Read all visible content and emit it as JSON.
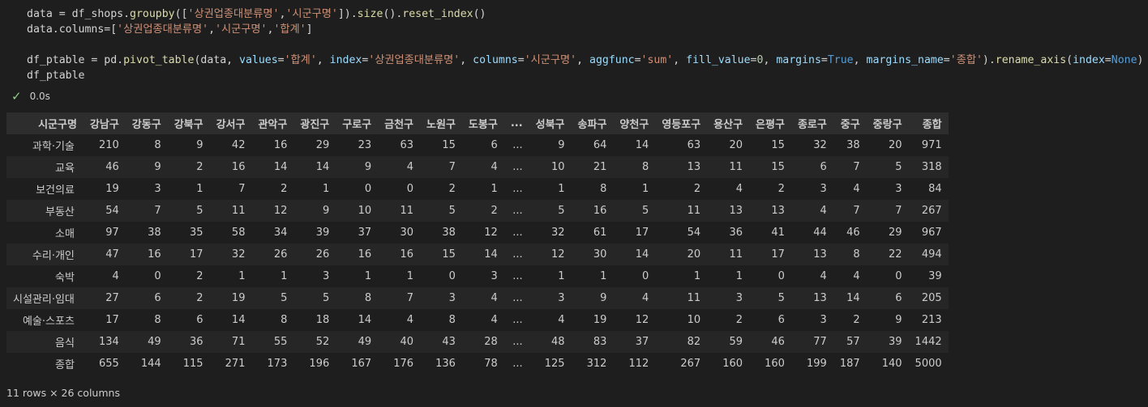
{
  "code_lines": [
    [
      {
        "t": "data = df_shops."
      },
      {
        "t": "groupby",
        "c": "fn"
      },
      {
        "t": "(["
      },
      {
        "t": "'상권업종대분류명'",
        "c": "str"
      },
      {
        "t": ","
      },
      {
        "t": "'시군구명'",
        "c": "str"
      },
      {
        "t": "])."
      },
      {
        "t": "size",
        "c": "fn"
      },
      {
        "t": "()."
      },
      {
        "t": "reset_index",
        "c": "fn"
      },
      {
        "t": "()"
      }
    ],
    [
      {
        "t": "data.columns=["
      },
      {
        "t": "'상권업종대분류명'",
        "c": "str"
      },
      {
        "t": ","
      },
      {
        "t": "'시군구명'",
        "c": "str"
      },
      {
        "t": ","
      },
      {
        "t": "'합계'",
        "c": "str"
      },
      {
        "t": "]"
      }
    ],
    [],
    [
      {
        "t": "df_ptable = pd."
      },
      {
        "t": "pivot_table",
        "c": "fn"
      },
      {
        "t": "(data, "
      },
      {
        "t": "values",
        "c": "var"
      },
      {
        "t": "="
      },
      {
        "t": "'합계'",
        "c": "str"
      },
      {
        "t": ", "
      },
      {
        "t": "index",
        "c": "var"
      },
      {
        "t": "="
      },
      {
        "t": "'상권업종대분류명'",
        "c": "str"
      },
      {
        "t": ", "
      },
      {
        "t": "columns",
        "c": "var"
      },
      {
        "t": "="
      },
      {
        "t": "'시군구명'",
        "c": "str"
      },
      {
        "t": ", "
      },
      {
        "t": "aggfunc",
        "c": "var"
      },
      {
        "t": "="
      },
      {
        "t": "'sum'",
        "c": "str"
      },
      {
        "t": ", "
      },
      {
        "t": "fill_value",
        "c": "var"
      },
      {
        "t": "="
      },
      {
        "t": "0",
        "c": "num"
      },
      {
        "t": ", "
      },
      {
        "t": "margins",
        "c": "var"
      },
      {
        "t": "="
      },
      {
        "t": "True",
        "c": "kw"
      },
      {
        "t": ", "
      },
      {
        "t": "margins_name",
        "c": "var"
      },
      {
        "t": "="
      },
      {
        "t": "'종합'",
        "c": "str"
      },
      {
        "t": ")."
      },
      {
        "t": "rename_axis",
        "c": "fn"
      },
      {
        "t": "("
      },
      {
        "t": "index",
        "c": "var"
      },
      {
        "t": "="
      },
      {
        "t": "None",
        "c": "kw"
      },
      {
        "t": ")"
      }
    ],
    [
      {
        "t": "df_ptable"
      }
    ]
  ],
  "status": {
    "check_icon": "check-icon",
    "time": "0.0s"
  },
  "table": {
    "headers": [
      "시군구명",
      "강남구",
      "강동구",
      "강북구",
      "강서구",
      "관악구",
      "광진구",
      "구로구",
      "금천구",
      "노원구",
      "도봉구",
      "...",
      "성북구",
      "송파구",
      "양천구",
      "영등포구",
      "용산구",
      "은평구",
      "종로구",
      "중구",
      "중랑구",
      "종합"
    ],
    "rows": [
      [
        "과학·기술",
        "210",
        "8",
        "9",
        "42",
        "16",
        "29",
        "23",
        "63",
        "15",
        "6",
        "...",
        "9",
        "64",
        "14",
        "63",
        "20",
        "15",
        "32",
        "38",
        "20",
        "971"
      ],
      [
        "교육",
        "46",
        "9",
        "2",
        "16",
        "14",
        "14",
        "9",
        "4",
        "7",
        "4",
        "...",
        "10",
        "21",
        "8",
        "13",
        "11",
        "15",
        "6",
        "7",
        "5",
        "318"
      ],
      [
        "보건의료",
        "19",
        "3",
        "1",
        "7",
        "2",
        "1",
        "0",
        "0",
        "2",
        "1",
        "...",
        "1",
        "8",
        "1",
        "2",
        "4",
        "2",
        "3",
        "4",
        "3",
        "84"
      ],
      [
        "부동산",
        "54",
        "7",
        "5",
        "11",
        "12",
        "9",
        "10",
        "11",
        "5",
        "2",
        "...",
        "5",
        "16",
        "5",
        "11",
        "13",
        "13",
        "4",
        "7",
        "7",
        "267"
      ],
      [
        "소매",
        "97",
        "38",
        "35",
        "58",
        "34",
        "39",
        "37",
        "30",
        "38",
        "12",
        "...",
        "32",
        "61",
        "17",
        "54",
        "36",
        "41",
        "44",
        "46",
        "29",
        "967"
      ],
      [
        "수리·개인",
        "47",
        "16",
        "17",
        "32",
        "26",
        "26",
        "16",
        "16",
        "15",
        "14",
        "...",
        "12",
        "30",
        "14",
        "20",
        "11",
        "17",
        "13",
        "8",
        "22",
        "494"
      ],
      [
        "숙박",
        "4",
        "0",
        "2",
        "1",
        "1",
        "3",
        "1",
        "1",
        "0",
        "3",
        "...",
        "1",
        "1",
        "0",
        "1",
        "1",
        "0",
        "4",
        "4",
        "0",
        "39"
      ],
      [
        "시설관리·임대",
        "27",
        "6",
        "2",
        "19",
        "5",
        "5",
        "8",
        "7",
        "3",
        "4",
        "...",
        "3",
        "9",
        "4",
        "11",
        "3",
        "5",
        "13",
        "14",
        "6",
        "205"
      ],
      [
        "예술·스포츠",
        "17",
        "8",
        "6",
        "14",
        "8",
        "18",
        "14",
        "4",
        "8",
        "4",
        "...",
        "4",
        "19",
        "12",
        "10",
        "2",
        "6",
        "3",
        "2",
        "9",
        "213"
      ],
      [
        "음식",
        "134",
        "49",
        "36",
        "71",
        "55",
        "52",
        "49",
        "40",
        "43",
        "28",
        "...",
        "48",
        "83",
        "37",
        "82",
        "59",
        "46",
        "77",
        "57",
        "39",
        "1442"
      ],
      [
        "종합",
        "655",
        "144",
        "115",
        "271",
        "173",
        "196",
        "167",
        "176",
        "136",
        "78",
        "...",
        "125",
        "312",
        "112",
        "267",
        "160",
        "160",
        "199",
        "187",
        "140",
        "5000"
      ]
    ]
  },
  "footer": "11 rows × 26 columns"
}
